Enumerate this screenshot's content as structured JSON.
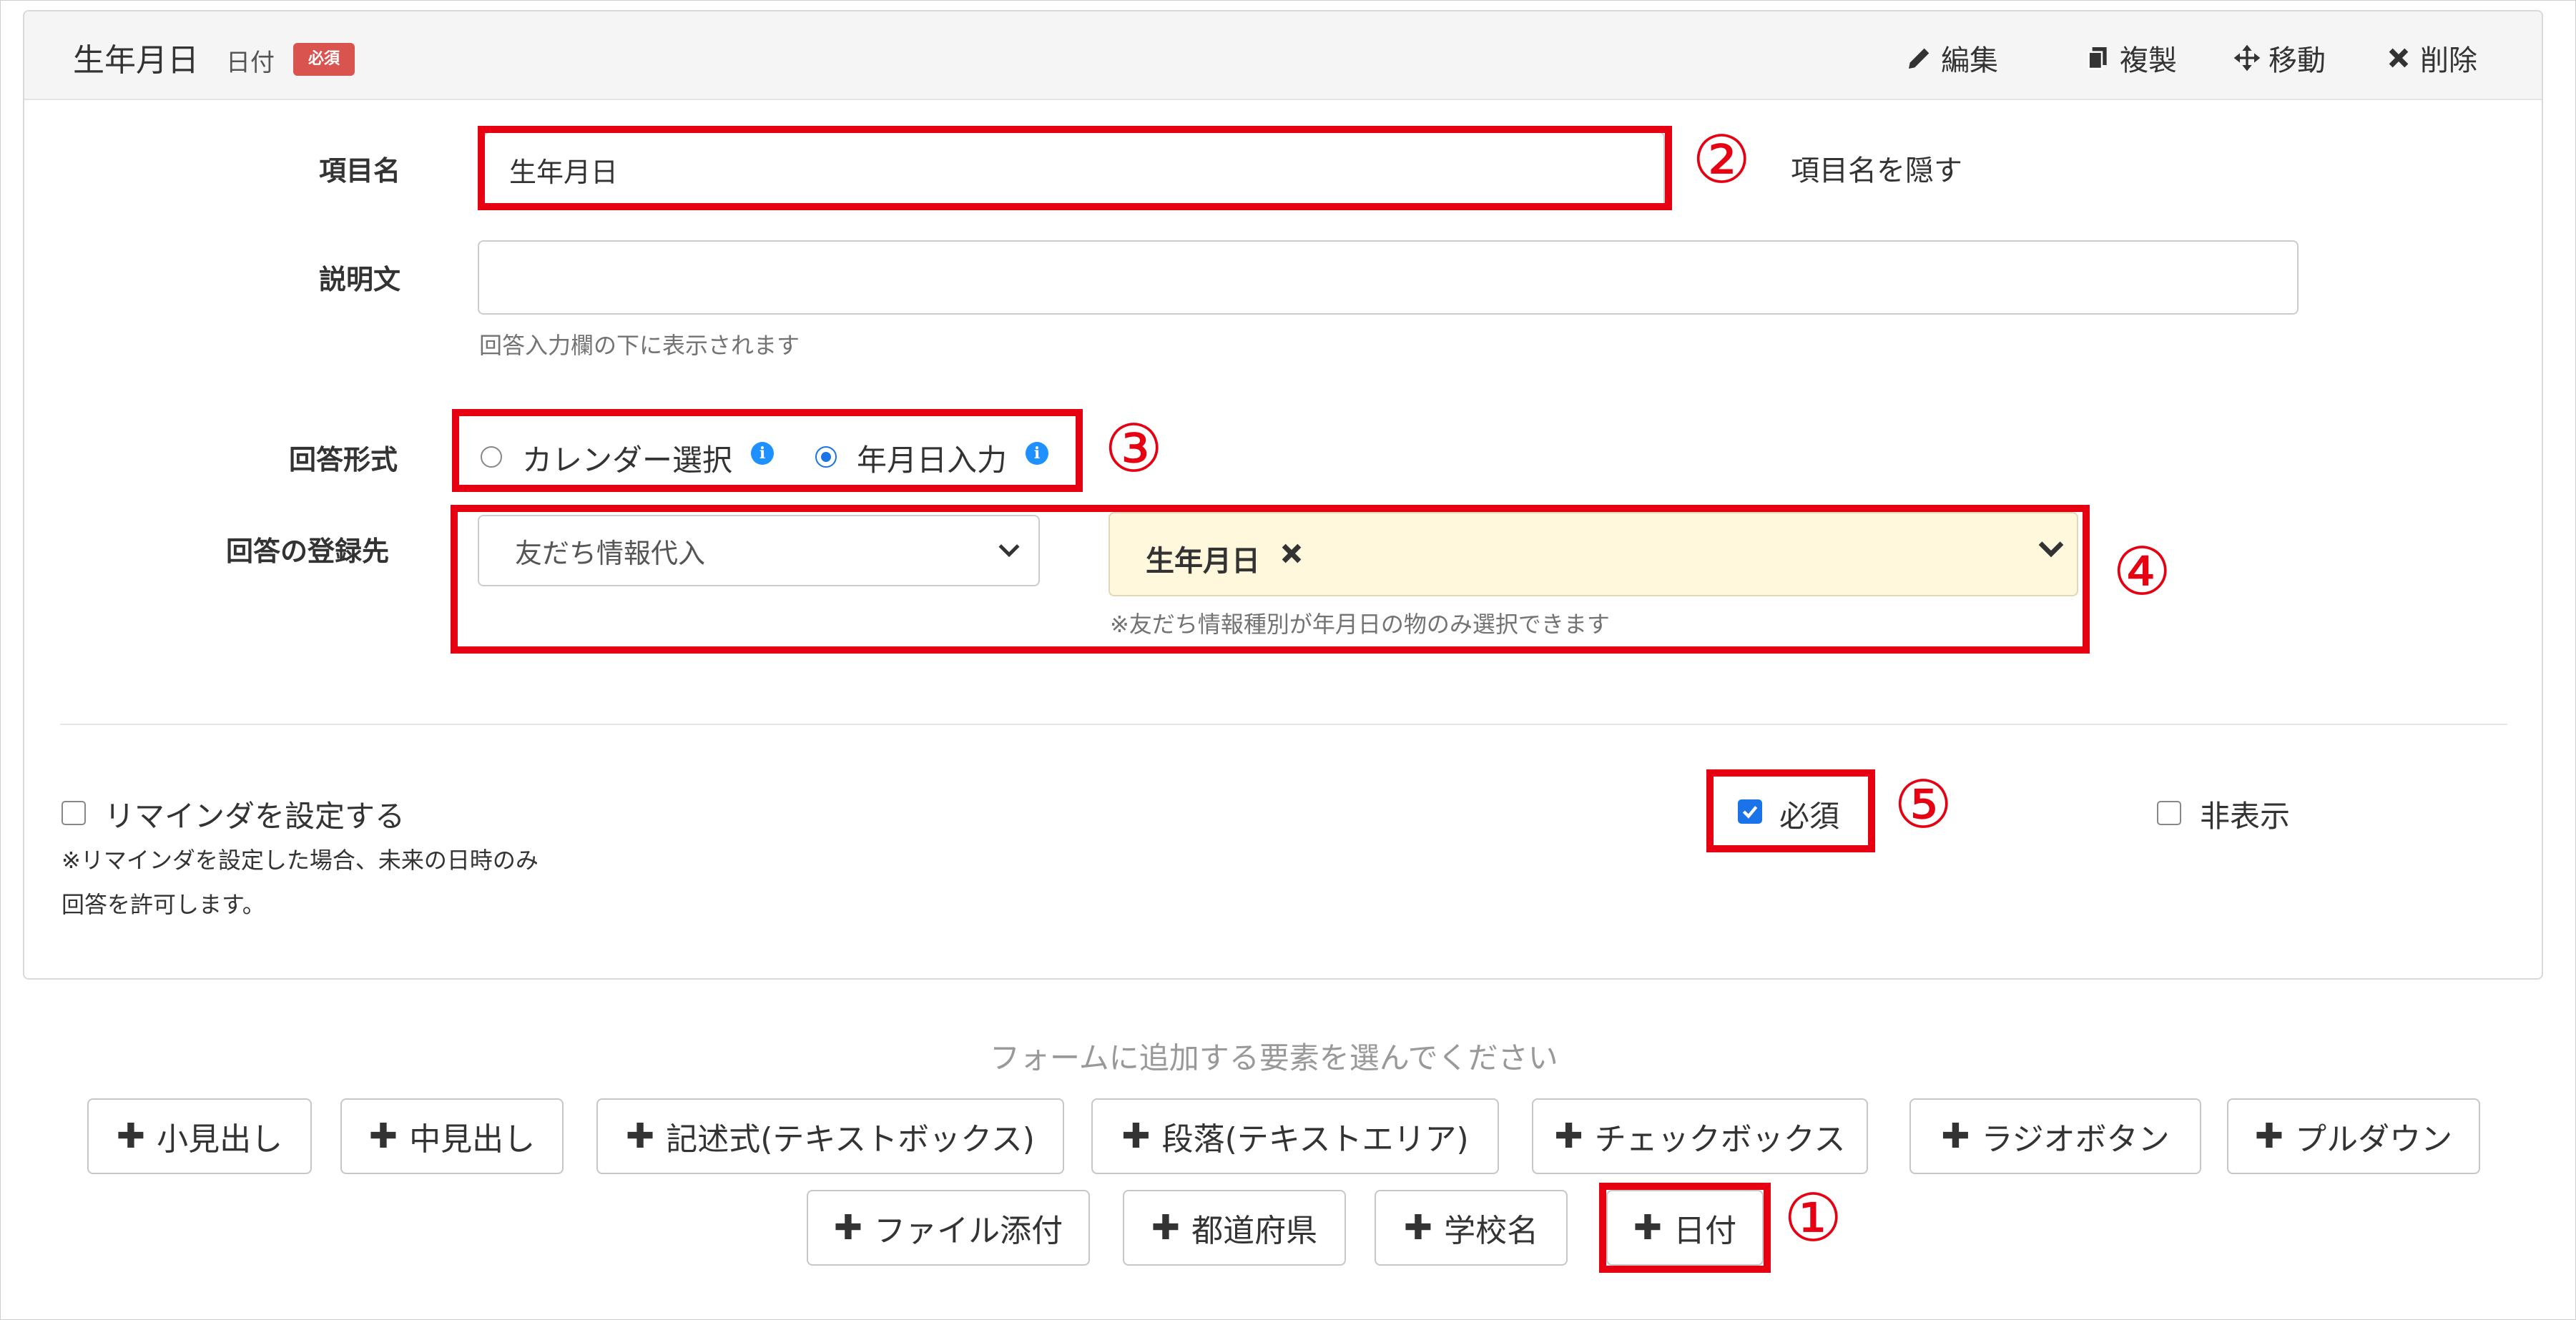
{
  "header": {
    "title": "生年月日",
    "type": "日付",
    "required_badge": "必須",
    "actions": [
      {
        "icon": "pencil-icon",
        "label": "編集"
      },
      {
        "icon": "copy-icon",
        "label": "複製"
      },
      {
        "icon": "move-icon",
        "label": "移動"
      },
      {
        "icon": "delete-icon",
        "label": "削除"
      }
    ]
  },
  "form": {
    "item_name_label": "項目名",
    "item_name_value": "生年月日",
    "hide_name_label": "項目名を隠す",
    "description_label": "説明文",
    "description_value": "",
    "description_help": "回答入力欄の下に表示されます",
    "answer_format_label": "回答形式",
    "answer_format_options": [
      "カレンダー選択",
      "年月日入力"
    ],
    "answer_format_selected": "年月日入力",
    "register_label": "回答の登録先",
    "register_select": "友だち情報代入",
    "register_tag": "生年月日",
    "register_help": "※友だち情報種別が年月日の物のみ選択できます",
    "reminder_label": "リマインダを設定する",
    "reminder_note_1": "※リマインダを設定した場合、未来の日時のみ",
    "reminder_note_2": "回答を許可します。",
    "required_label": "必須",
    "hidden_label": "非表示"
  },
  "add_section": {
    "prompt": "フォームに追加する要素を選んでください",
    "buttons_row1": [
      "小見出し",
      "中見出し",
      "記述式(テキストボックス)",
      "段落(テキストエリア)",
      "チェックボックス",
      "ラジオボタン",
      "プルダウン"
    ],
    "buttons_row2": [
      "ファイル添付",
      "都道府県",
      "学校名",
      "日付"
    ]
  },
  "annotations": [
    "①",
    "②",
    "③",
    "④",
    "⑤"
  ],
  "colors": {
    "accent": "#e60012",
    "badge": "#d9534f",
    "highlight": "#fff8dc",
    "radio": "#1a73e8"
  }
}
